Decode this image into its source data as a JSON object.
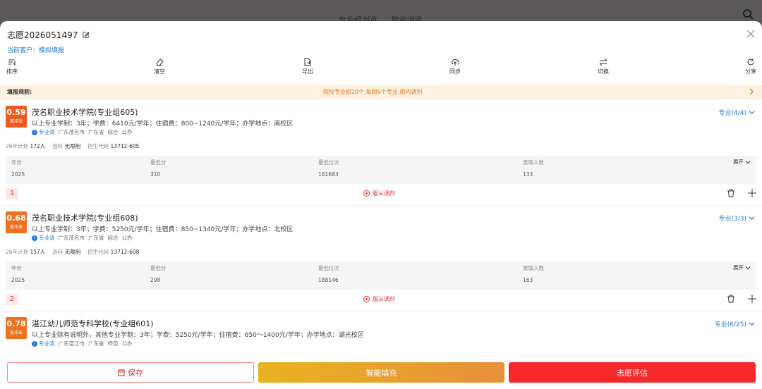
{
  "topbar": {
    "tab_major": "专业组浏览",
    "tab_school": "院校浏览"
  },
  "header": {
    "title": "志愿2026051497",
    "customer_label": "当前客户：",
    "customer_name": "模拟填报"
  },
  "toolbar": [
    {
      "label": "排序",
      "icon": "sort-icon"
    },
    {
      "label": "清空",
      "icon": "eraser-icon"
    },
    {
      "label": "导出",
      "icon": "export-icon"
    },
    {
      "label": "同步",
      "icon": "cloud-sync-icon"
    },
    {
      "label": "切换",
      "icon": "switch-icon"
    },
    {
      "label": "分享",
      "icon": "share-icon"
    }
  ],
  "rule": {
    "label": "填报规则:",
    "text": "院校专业组20个,每组6个专业,组内调剂"
  },
  "cards": [
    {
      "score": "0.59",
      "tag": "高冲击",
      "school": "茂名职业技术学院(专业组605)",
      "desc": "以上专业学制：3年；学费：6410元/学年；住宿费：800~1240元/学年；办学地点：南校区",
      "major_link": "专业清",
      "city": "广东茂名市",
      "province": "广东省",
      "kind": "综合",
      "ownership": "公办",
      "major_count": "专业(4/4)",
      "plan_label": "26年计划",
      "plan_value": "172人",
      "subject_label": "选科",
      "subject_value": "无限制",
      "code_label": "招生代码",
      "code_value": "13712-605",
      "table_head": [
        "年份",
        "最低分",
        "最低位次",
        "录取人数"
      ],
      "table_row": [
        "2025",
        "310",
        "161683",
        "133"
      ],
      "expand": "展开",
      "index": "1",
      "obey": "服从调剂"
    },
    {
      "score": "0.68",
      "tag": "低冲击",
      "school": "茂名职业技术学院(专业组608)",
      "desc": "以上专业学制：3年；学费：5250元/学年；住宿费：850~1340元/学年；办学地点：北校区",
      "major_link": "专业清",
      "city": "广东茂名市",
      "province": "广东省",
      "kind": "综合",
      "ownership": "公办",
      "major_count": "专业(3/3)",
      "plan_label": "26年计划",
      "plan_value": "157人",
      "subject_label": "选科",
      "subject_value": "无限制",
      "code_label": "招生代码",
      "code_value": "13712-608",
      "table_head": [
        "年份",
        "最低分",
        "最低位次",
        "录取人数"
      ],
      "table_row": [
        "2025",
        "298",
        "188146",
        "163"
      ],
      "expand": "展开",
      "index": "2",
      "obey": "服从调剂"
    },
    {
      "score": "0.78",
      "tag": "低冲击",
      "school": "湛江幼儿师范专科学校(专业组601)",
      "desc": "以上专业除有说明外，其他专业学制：3年；学费：5250元/学年；住宿费：650～1400元/学年；办学地点：湖光校区",
      "major_link": "专业清",
      "city": "广东湛江市",
      "province": "广东省",
      "kind": "师范",
      "ownership": "公办",
      "major_count": "专业(6/25)"
    }
  ],
  "bottom": {
    "save": "保存",
    "smart": "智能填充",
    "evaluate": "志愿评估"
  }
}
